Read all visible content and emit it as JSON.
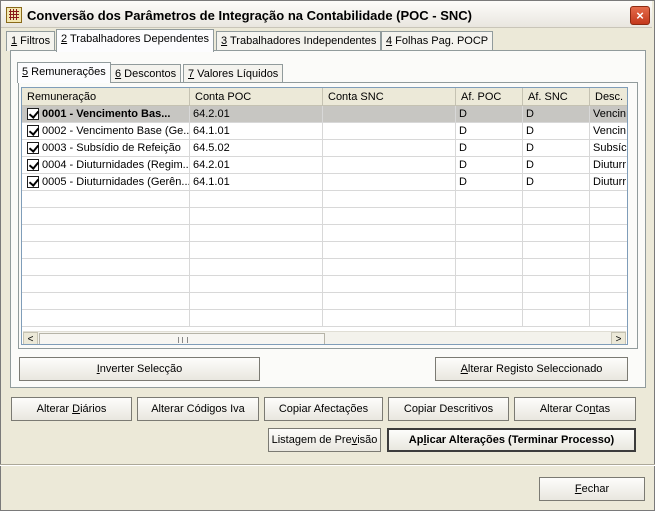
{
  "window": {
    "title": "Conversão dos Parâmetros de Integração na Contabilidade (POC - SNC)",
    "close_label": "×"
  },
  "tabs": [
    {
      "key": "1",
      "label": " Filtros"
    },
    {
      "key": "2",
      "label": " Trabalhadores Dependentes"
    },
    {
      "key": "3",
      "label": " Trabalhadores Independentes"
    },
    {
      "key": "4",
      "label": " Folhas Pag. POCP"
    }
  ],
  "subtabs": [
    {
      "key": "5",
      "label": " Remunerações"
    },
    {
      "key": "6",
      "label": " Descontos"
    },
    {
      "key": "7",
      "label": " Valores Líquidos"
    }
  ],
  "grid": {
    "columns": [
      "Remuneração",
      "Conta POC",
      "Conta SNC",
      "Af. POC",
      "Af. SNC",
      "Desc."
    ],
    "rows": [
      {
        "checked": true,
        "remuneracao": "0001 - Vencimento Bas...",
        "conta_poc": "64.2.01",
        "conta_snc": "",
        "af_poc": "D",
        "af_snc": "D",
        "desc": "Vencin"
      },
      {
        "checked": true,
        "remuneracao": "0002 - Vencimento Base (Ge...",
        "conta_poc": "64.1.01",
        "conta_snc": "",
        "af_poc": "D",
        "af_snc": "D",
        "desc": "Vencin"
      },
      {
        "checked": true,
        "remuneracao": "0003 - Subsídio de Refeição",
        "conta_poc": "64.5.02",
        "conta_snc": "",
        "af_poc": "D",
        "af_snc": "D",
        "desc": "Subsíc"
      },
      {
        "checked": true,
        "remuneracao": "0004 - Diuturnidades (Regim...",
        "conta_poc": "64.2.01",
        "conta_snc": "",
        "af_poc": "D",
        "af_snc": "D",
        "desc": "Diuturr"
      },
      {
        "checked": true,
        "remuneracao": "0005 - Diuturnidades (Gerên...",
        "conta_poc": "64.1.01",
        "conta_snc": "",
        "af_poc": "D",
        "af_snc": "D",
        "desc": "Diuturr"
      }
    ]
  },
  "scrollbar": {
    "left_arrow": "<",
    "right_arrow": ">"
  },
  "buttons": {
    "inverter_pre": "",
    "inverter_key": "I",
    "inverter_post": "nverter Selecção",
    "alterar_registo_pre": "",
    "alterar_registo_key": "A",
    "alterar_registo_post": "lterar Registo Seleccionado",
    "alterar_diarios_pre": "Alterar ",
    "alterar_diarios_key": "D",
    "alterar_diarios_post": "iários",
    "alterar_codigos_iva": "Alterar Códigos Iva",
    "copiar_afectacoes": "Copiar Afectações",
    "copiar_descritivos": "Copiar Descritivos",
    "alterar_contas_pre": "Alterar Co",
    "alterar_contas_key": "n",
    "alterar_contas_post": "tas",
    "listagem_pre": "Listagem de Pre",
    "listagem_key": "v",
    "listagem_post": "isão",
    "aplicar_pre": "Ap",
    "aplicar_key": "l",
    "aplicar_post": "icar Alterações (Terminar Processo)",
    "fechar_pre": "",
    "fechar_key": "F",
    "fechar_post": "echar"
  }
}
